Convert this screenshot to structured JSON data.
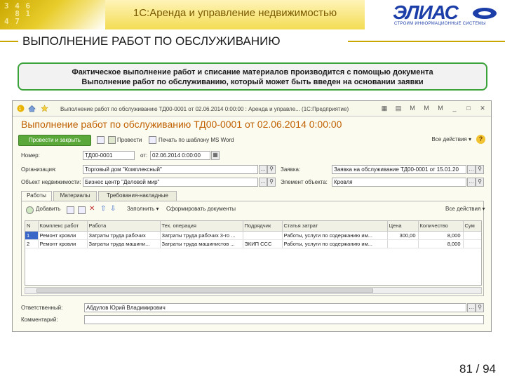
{
  "slide": {
    "app_title": "1С:Аренда и управление недвижимостью",
    "title": "ВЫПОЛНЕНИЕ РАБОТ ПО ОБСЛУЖИВАНИЮ",
    "logo_text": "ЭЛИАС",
    "logo_subtitle": "СТРОИМ ИНФОРМАЦИОННЫЕ СИСТЕМЫ",
    "callout_line1": "Фактическое выполнение работ и списание материалов производится с помощью документа",
    "callout_line2": "Выполнение работ по обслуживанию, который может быть введен на основании заявки",
    "page_number": "81 / 94",
    "accent_color": "#c9a600",
    "callout_border_color": "#3aa33a"
  },
  "window": {
    "title": "Выполнение работ по обслуживанию ТД00-0001 от 02.06.2014 0:00:00 : Аренда и управле... (1С:Предприятие)",
    "doc_title": "Выполнение работ по обслуживанию ТД00-0001 от 02.06.2014 0:00:00",
    "toolbar": {
      "post_close": "Провести и закрыть",
      "post": "Провести",
      "print_template": "Печать по шаблону MS Word",
      "actions": "Все действия",
      "help": "?"
    },
    "form": {
      "number_label": "Номер:",
      "number_value": "ТД00-0001",
      "date_label": "от:",
      "date_value": "02.06.2014 0:00:00",
      "org_label": "Организация:",
      "org_value": "Торговый дом \"Комплексный\"",
      "request_label": "Заявка:",
      "request_value": "Заявка на обслуживание ТД00-0001 от 15.01.20",
      "site_label": "Объект недвижимости:",
      "site_value": "Бизнес центр \"Деловой мир\"",
      "element_label": "Элемент объекта:",
      "element_value": "Кровля"
    },
    "tabs": [
      "Работы",
      "Материалы",
      "Требования-накладные"
    ],
    "table_toolbar": {
      "add": "Добавить",
      "fill": "Заполнить",
      "generate": "Сформировать документы",
      "actions": "Все действия"
    },
    "table": {
      "headers": [
        "N",
        "Комплекс работ",
        "Работа",
        "Тех. операция",
        "Подрядчик",
        "Статья затрат",
        "Цена",
        "Количество",
        "Сум"
      ],
      "rows": [
        [
          "1",
          "Ремонт кровли",
          "Затраты труда рабочих",
          "Затраты труда рабочих 3-го ...",
          "",
          "Работы, услуги по содержанию им...",
          "300,00",
          "8,000",
          ""
        ],
        [
          "2",
          "Ремонт кровли",
          "Затраты труда машини...",
          "Затраты труда машинистов ...",
          "ЭКИП ССС",
          "Работы, услуги по содержанию им...",
          "",
          "8,000",
          ""
        ]
      ]
    },
    "responsible_label": "Ответственный:",
    "responsible_value": "Абдулов Юрий Владимирович",
    "comment_label": "Комментарий:",
    "comment_value": "",
    "selection_color": "#3a66c8",
    "doc_title_color": "#c06000",
    "post_button_color": "#5aa83a"
  }
}
